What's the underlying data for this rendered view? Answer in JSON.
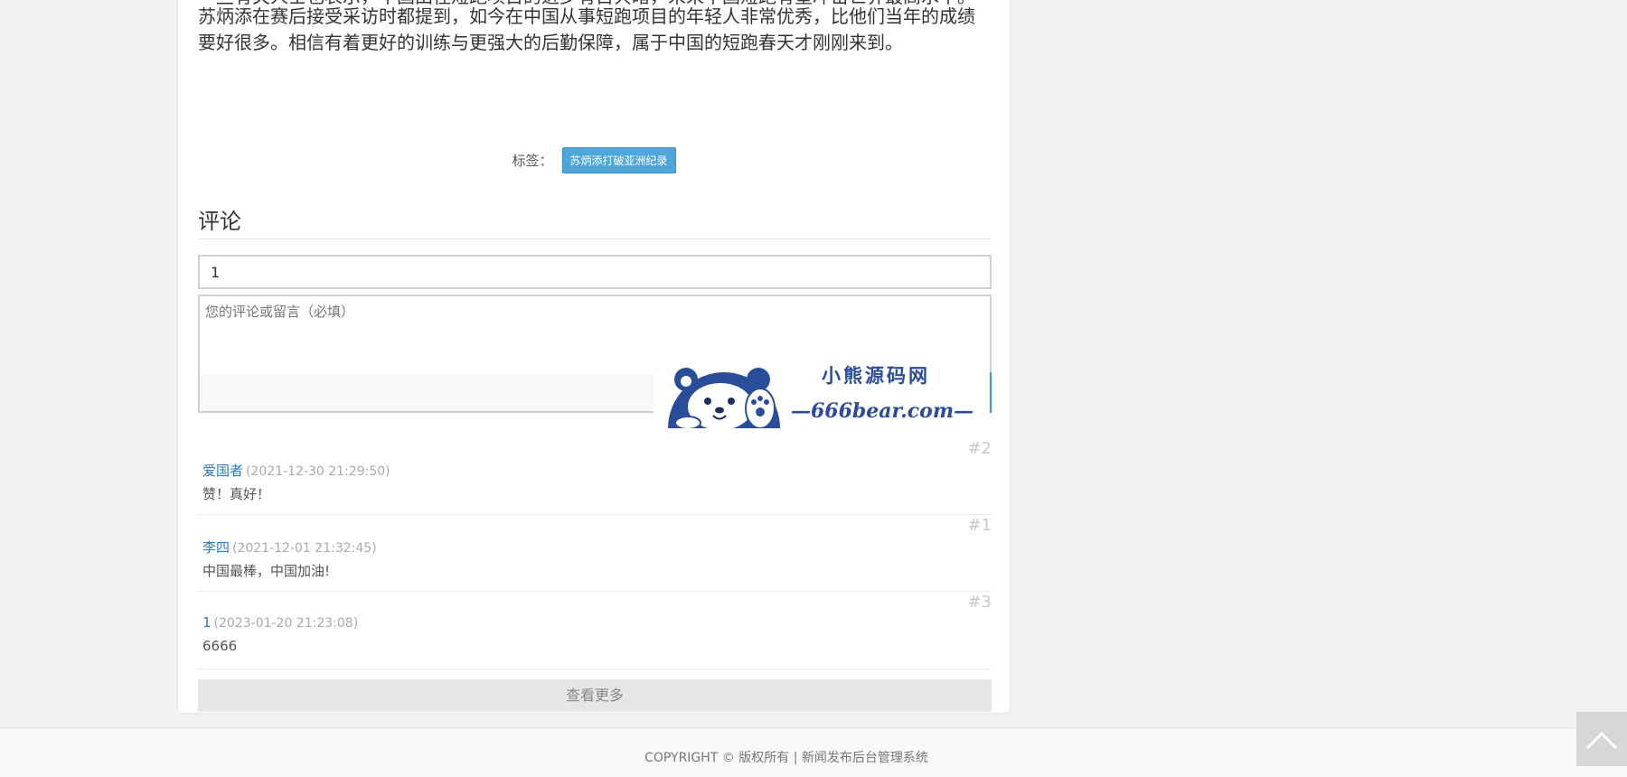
{
  "article": {
    "cut_line": "一些有关人士也表示，中国田径短跑项目的进步有目共睹，未来中国短跑有望冲击世界最高水平。",
    "paragraph_line1": "苏炳添在赛后接受采访时都提到，如今在中国从事短跑项目的年轻人非常优秀，比他们当年的成绩",
    "paragraph_line2": "要好很多。相信有着更好的训练与更强大的后勤保障，属于中国的短跑春天才刚刚来到。"
  },
  "tags": {
    "label": "标签：",
    "items": [
      "苏炳添打破亚洲纪录"
    ]
  },
  "comments_section": {
    "title": "评论",
    "name_value": "1",
    "textarea_placeholder": "您的评论或留言（必填）",
    "items": [
      {
        "floor": "#2",
        "author": "爱国者",
        "time": "(2021-12-30 21:29:50)",
        "body": "赞！真好！"
      },
      {
        "floor": "#1",
        "author": "李四",
        "time": "(2021-12-01 21:32:45)",
        "body": "中国最棒，中国加油!"
      },
      {
        "floor": "#3",
        "author": "1",
        "time": "(2023-01-20 21:23:08)",
        "body": "6666"
      }
    ],
    "more_label": "查看更多"
  },
  "watermark": {
    "title": "小熊源码网",
    "url": "—666bear.com—"
  },
  "footer": {
    "copyright": "COPYRIGHT © 版权所有 | 新闻发布后台管理系统"
  },
  "colors": {
    "accent": "#3596d3",
    "tag_bg": "#4fa6d8",
    "link": "#2f7bbd",
    "brand": "#2a4d9a"
  },
  "icons": {
    "back_to_top": "chevron-up-icon"
  }
}
